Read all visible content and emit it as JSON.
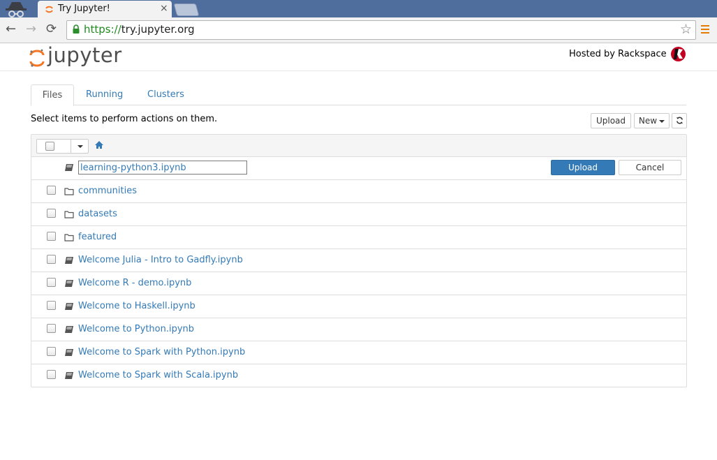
{
  "browser": {
    "tab_title": "Try Jupyter!",
    "tab_close": "×",
    "url_scheme": "https://",
    "url_rest": "try.jupyter.org",
    "star": "☆",
    "nav_back": "←",
    "nav_forward": "→",
    "nav_reload": "⟳"
  },
  "header": {
    "logo_text": "jupyter",
    "hosted_by": "Hosted by Rackspace"
  },
  "tabs": [
    {
      "label": "Files"
    },
    {
      "label": "Running"
    },
    {
      "label": "Clusters"
    }
  ],
  "toolbar": {
    "hint": "Select items to perform actions on them.",
    "upload_label": "Upload",
    "new_label": "New"
  },
  "upload_row": {
    "filename": "learning-python3.ipynb",
    "upload_label": "Upload",
    "cancel_label": "Cancel"
  },
  "items": [
    {
      "name": "communities",
      "type": "folder"
    },
    {
      "name": "datasets",
      "type": "folder"
    },
    {
      "name": "featured",
      "type": "folder"
    },
    {
      "name": "Welcome Julia - Intro to Gadfly.ipynb",
      "type": "notebook"
    },
    {
      "name": "Welcome R - demo.ipynb",
      "type": "notebook"
    },
    {
      "name": "Welcome to Haskell.ipynb",
      "type": "notebook"
    },
    {
      "name": "Welcome to Python.ipynb",
      "type": "notebook"
    },
    {
      "name": "Welcome to Spark with Python.ipynb",
      "type": "notebook"
    },
    {
      "name": "Welcome to Spark with Scala.ipynb",
      "type": "notebook"
    }
  ],
  "colors": {
    "link": "#337ab7",
    "primary": "#337ab7",
    "jupyter_orange": "#f37726",
    "tabstrip": "#4f6e9e"
  }
}
